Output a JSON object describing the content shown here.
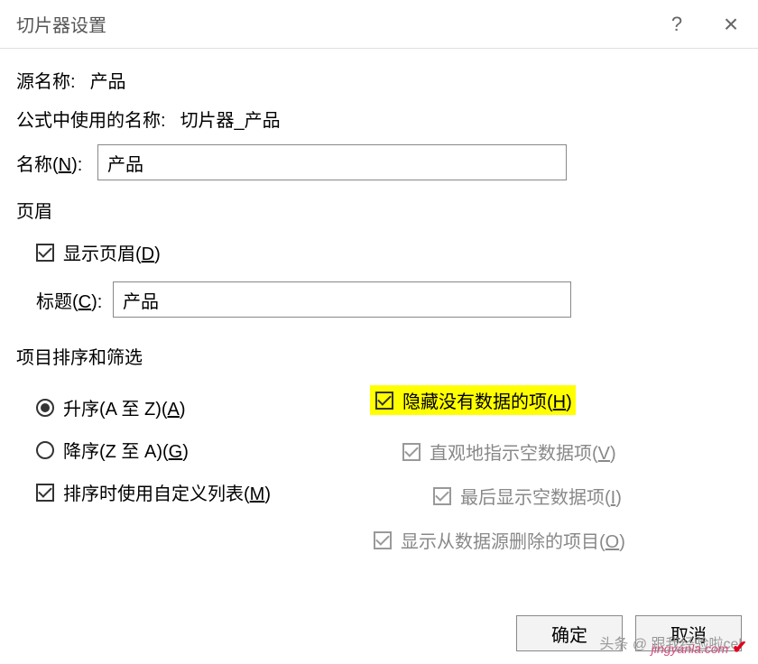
{
  "titlebar": {
    "title": "切片器设置",
    "help": "?",
    "close": "×"
  },
  "source": {
    "label": "源名称:",
    "value": "产品"
  },
  "formula": {
    "label": "公式中使用的名称:",
    "value": "切片器_产品"
  },
  "name": {
    "label": "名称(",
    "mn": "N",
    "label2": "):",
    "value": "产品"
  },
  "header": {
    "section": "页眉",
    "show": {
      "label": "显示页眉(",
      "mn": "D",
      "label2": ")"
    },
    "caption": {
      "label": "标题(",
      "mn": "C",
      "label2": "):",
      "value": "产品"
    }
  },
  "sortfilter": {
    "section": "项目排序和筛选",
    "asc": {
      "label": "升序(A 至 Z)(",
      "mn": "A",
      "label2": ")"
    },
    "desc": {
      "label": "降序(Z 至 A)(",
      "mn": "G",
      "label2": ")"
    },
    "custom": {
      "label": "排序时使用自定义列表(",
      "mn": "M",
      "label2": ")"
    },
    "hide": {
      "label": "隐藏没有数据的项(",
      "mn": "H",
      "label2": ")"
    },
    "indirect": {
      "label": "直观地指示空数据项(",
      "mn": "V",
      "label2": ")"
    },
    "last": {
      "label": "最后显示空数据项(",
      "mn": "I",
      "label2": ")"
    },
    "show": {
      "label": "显示从数据源删除的项目(",
      "mn": "O",
      "label2": ")"
    }
  },
  "buttons": {
    "ok": "确定",
    "cancel": "取消"
  },
  "watermark": {
    "line1": "头条 @ 跟我经验啦cel",
    "line2": "jingyanla.com",
    "check": "✔"
  }
}
